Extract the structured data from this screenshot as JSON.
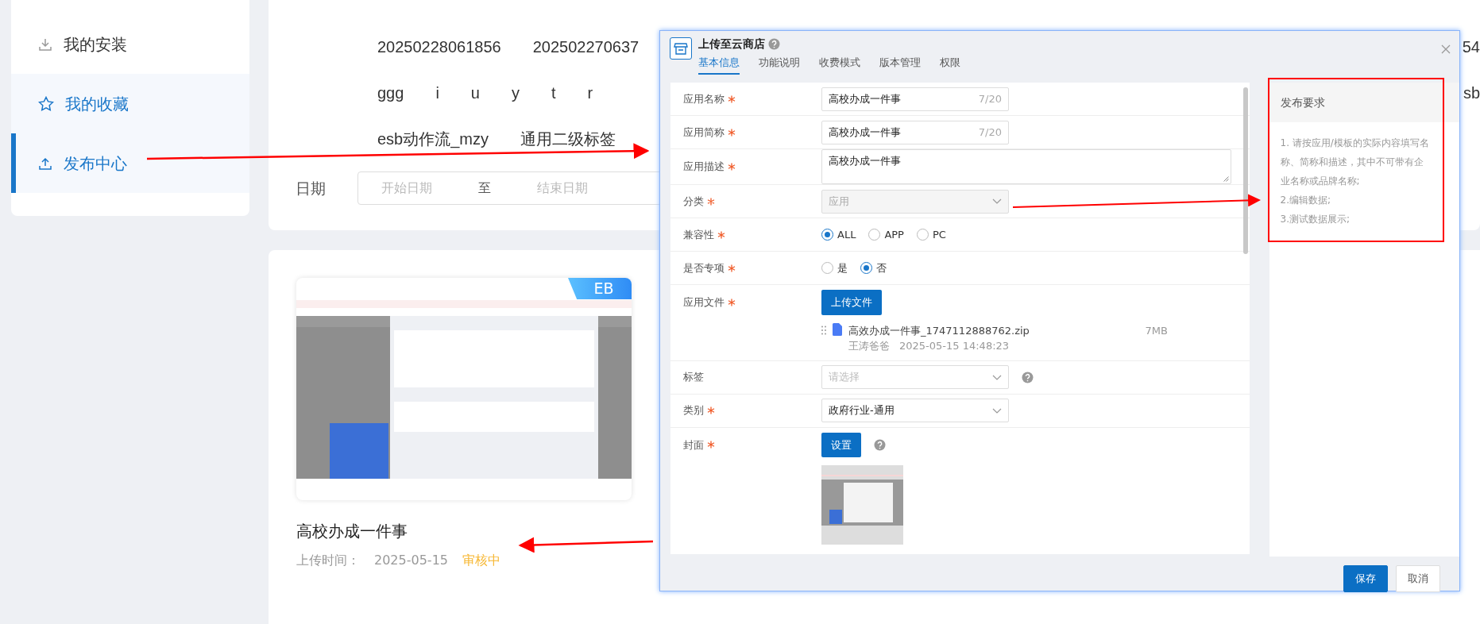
{
  "sidebar": {
    "items": [
      {
        "label": "我的安装",
        "selected": false,
        "hovered": false
      },
      {
        "label": "我的收藏",
        "selected": false,
        "hovered": true
      },
      {
        "label": "发布中心",
        "selected": true,
        "hovered": false
      }
    ]
  },
  "filter": {
    "tag_rows": [
      {
        "tags": [
          "20250228061856",
          "202502270637"
        ],
        "trailing": "54"
      },
      {
        "tags": [
          "ggg",
          "i",
          "u",
          "y",
          "t",
          "r"
        ],
        "trailing": "sb"
      },
      {
        "tags": [
          "esb动作流_mzy",
          "通用二级标签"
        ]
      }
    ],
    "date": {
      "label": "日期",
      "start_placeholder": "开始日期",
      "separator": "至",
      "end_placeholder": "结束日期"
    }
  },
  "cards": [
    {
      "badge": "EB",
      "title": "高校办成一件事",
      "upload_label": "上传时间：",
      "upload_date": "2025-05-15",
      "status": "审核中"
    }
  ],
  "dialog": {
    "title": "上传至云商店",
    "tabs": [
      {
        "label": "基本信息",
        "selected": true
      },
      {
        "label": "功能说明",
        "selected": false
      },
      {
        "label": "收费模式",
        "selected": false
      },
      {
        "label": "版本管理",
        "selected": false
      },
      {
        "label": "权限",
        "selected": false
      }
    ],
    "form": [
      {
        "kind": "input",
        "label": "应用名称",
        "required": true,
        "value": "高校办成一件事",
        "counter": "7/20"
      },
      {
        "kind": "input",
        "label": "应用简称",
        "required": true,
        "value": "高校办成一件事",
        "counter": "7/20"
      },
      {
        "kind": "textarea",
        "label": "应用描述",
        "required": true,
        "value": "高校办成一件事"
      },
      {
        "kind": "select",
        "label": "分类",
        "required": true,
        "value": "应用",
        "disabled": true
      },
      {
        "kind": "radio",
        "label": "兼容性",
        "required": true,
        "options": [
          {
            "label": "ALL",
            "selected": true
          },
          {
            "label": "APP",
            "selected": false
          },
          {
            "label": "PC",
            "selected": false
          }
        ]
      },
      {
        "kind": "radio",
        "label": "是否专项",
        "required": true,
        "options": [
          {
            "label": "是",
            "selected": false
          },
          {
            "label": "否",
            "selected": true
          }
        ]
      },
      {
        "kind": "upload",
        "label": "应用文件",
        "required": true,
        "button": "上传文件",
        "file": {
          "name": "高效办成一件事_1747112888762.zip",
          "size": "7MB",
          "uploader": "王涛爸爸",
          "time": "2025-05-15 14:48:23"
        }
      },
      {
        "kind": "select",
        "label": "标签",
        "required": false,
        "placeholder": "请选择",
        "disabled": false,
        "help": true
      },
      {
        "kind": "select",
        "label": "类别",
        "required": true,
        "value": "政府行业-通用",
        "disabled": false
      },
      {
        "kind": "cover",
        "label": "封面",
        "required": true,
        "button": "设置",
        "help": true
      }
    ],
    "requirements": {
      "title": "发布要求",
      "text": "1. 请按应用/模板的实际内容填写名称、简称和描述，其中不可带有企业名称或品牌名称;",
      "lines": [
        "2.编辑数据;",
        "3.测试数据展示;"
      ]
    },
    "buttons": [
      {
        "label": "保存",
        "kind": "primary"
      },
      {
        "label": "取消",
        "kind": "default"
      }
    ]
  }
}
